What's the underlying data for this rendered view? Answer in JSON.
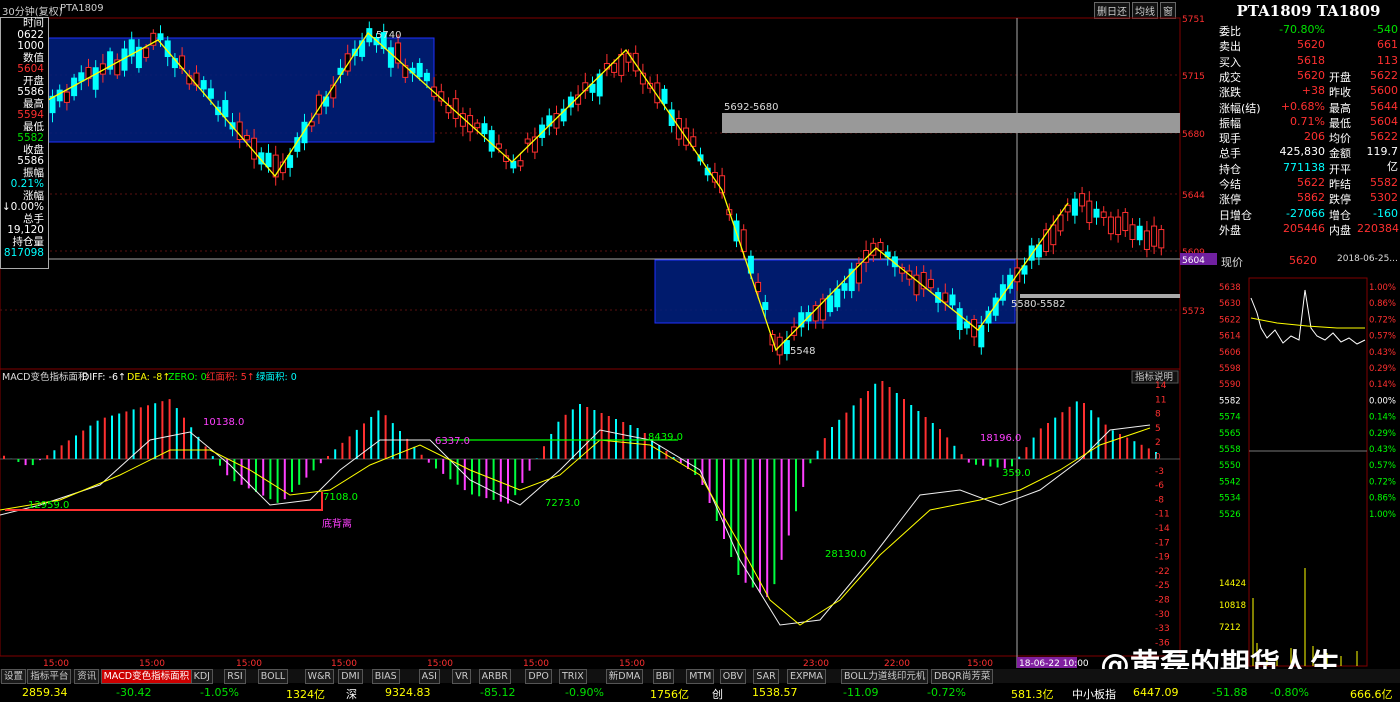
{
  "window": {
    "interval": "30分钟(复权)",
    "symbol": "PTA1809",
    "buttons": [
      "[除]",
      "[除权]",
      "[+]",
      "[x]"
    ],
    "btn_labels": [
      "删日还",
      "均线",
      "窗",
      "|"
    ]
  },
  "left_panel": [
    {
      "label": "时间",
      "value": "0622"
    },
    {
      "label": "",
      "value": "1000"
    },
    {
      "label": "数值",
      "value": "5604"
    },
    {
      "label": "开盘",
      "value": "5586"
    },
    {
      "label": "最高",
      "value": "5594"
    },
    {
      "label": "最低",
      "value": "5582"
    },
    {
      "label": "收盘",
      "value": "5586"
    },
    {
      "label": "振幅",
      "value": "0.21%"
    },
    {
      "label": "涨幅",
      "value": "↓0.00%"
    },
    {
      "label": "总手",
      "value": "19,120"
    },
    {
      "label": "持仓量",
      "value": "817098"
    }
  ],
  "main_chart": {
    "price_labels": [
      "5751",
      "5715",
      "5680",
      "5644",
      "5609",
      "5604",
      "5573"
    ],
    "annotations": [
      "5740",
      "5692-5680",
      "5548",
      "5580-5582"
    ],
    "time_labels": [
      "15:00",
      "15:00",
      "15:00",
      "15:00",
      "15:00",
      "15:00",
      "15:00",
      "23:00",
      "22:00",
      "15:00"
    ],
    "cursor_date": "18-06-22 10:00",
    "current_price_tag": "5604"
  },
  "indicator": {
    "title": "MACD变色指标面积",
    "diff": "DIFF: -6↑",
    "dea": "DEA: -8↑",
    "zero": "ZERO: 0",
    "red_area": "红面积: 5↑",
    "green_area": "绿面积: 0",
    "explain": "指标说明",
    "scale": [
      "14",
      "11",
      "8",
      "5",
      "2",
      "0",
      "-3",
      "-6",
      "-8",
      "-11",
      "-14",
      "-17",
      "-19",
      "-22",
      "-25",
      "-28",
      "-30",
      "-33",
      "-36"
    ],
    "annotations": [
      "10138.0",
      "12959.0",
      "7108.0",
      "底背离",
      "7273.0",
      "8439.0",
      "6337.0",
      "18196.0",
      "359.0",
      "28130.0"
    ]
  },
  "right_panel": {
    "title": "PTA1809 TA1809",
    "rows": [
      {
        "l": "委比",
        "v": "-70.80%",
        "v2": "-540",
        "c": "green"
      },
      {
        "l": "卖出",
        "v": "5620",
        "v2": "661",
        "c": "red"
      },
      {
        "l": "买入",
        "v": "5618",
        "v2": "113",
        "c": "red"
      },
      {
        "l": "成交",
        "v": "5620",
        "l2": "开盘",
        "v2": "5622",
        "c": "red"
      },
      {
        "l": "涨跌",
        "v": "+38",
        "l2": "昨收",
        "v2": "5600",
        "c": "red"
      },
      {
        "l": "涨幅(结)",
        "v": "+0.68%",
        "l2": "最高",
        "v2": "5644",
        "c": "red"
      },
      {
        "l": "振幅",
        "v": "0.71%",
        "l2": "最低",
        "v2": "5604",
        "c": "red"
      },
      {
        "l": "现手",
        "v": "206",
        "l2": "均价",
        "v2": "5622",
        "c": "red"
      },
      {
        "l": "总手",
        "v": "425,830",
        "l2": "金额",
        "v2": "119.7亿",
        "c": "white"
      },
      {
        "l": "持仓",
        "v": "771138",
        "l2": "开平",
        "v2": "",
        "c": "cyan"
      },
      {
        "l": "今结",
        "v": "5622",
        "l2": "昨结",
        "v2": "5582",
        "c": "red"
      },
      {
        "l": "涨停",
        "v": "5862",
        "l2": "跌停",
        "v2": "5302",
        "c": "red"
      },
      {
        "l": "日增仓",
        "v": "-27066",
        "l2": "增仓",
        "v2": "-160",
        "c": "cyan"
      },
      {
        "l": "外盘",
        "v": "205446",
        "l2": "内盘",
        "v2": "220384",
        "c": "red"
      }
    ],
    "now_label": "现价",
    "now_value": "5620",
    "now_date": "2018-06-25...",
    "mini_prices": [
      "5638",
      "5630",
      "5622",
      "5614",
      "5606",
      "5598",
      "5590",
      "5582",
      "5574",
      "5565",
      "5558",
      "5550",
      "5542",
      "5534",
      "5526"
    ],
    "mini_pcts": [
      "1.00%",
      "0.86%",
      "0.72%",
      "0.57%",
      "0.43%",
      "0.29%",
      "0.14%",
      "0.00%",
      "0.14%",
      "0.29%",
      "0.43%",
      "0.57%",
      "0.72%",
      "0.86%",
      "1.00%"
    ],
    "mini_vol": [
      "14424",
      "10818",
      "7212"
    ]
  },
  "tabs": [
    "设置",
    "指标平台",
    "资讯",
    "MACD变色指标面积",
    "KDJ",
    "RSI",
    "BOLL",
    "W&R",
    "DMI",
    "BIAS",
    "ASI",
    "VR",
    "ARBR",
    "DPO",
    "TRIX",
    "新DMA",
    "BBI",
    "MTM",
    "OBV",
    "SAR",
    "EXPMA",
    "BOLL力道线印元机",
    "DBQR尚芳菜"
  ],
  "status": [
    {
      "t": "2859.34",
      "c": "yellow"
    },
    {
      "t": "-30.42",
      "c": "green"
    },
    {
      "t": "-1.05%",
      "c": "green"
    },
    {
      "t": "1324亿",
      "c": "yellow"
    },
    {
      "t": "深",
      "c": "white"
    },
    {
      "t": "9324.83",
      "c": "yellow"
    },
    {
      "t": "-85.12",
      "c": "green"
    },
    {
      "t": "-0.90%",
      "c": "green"
    },
    {
      "t": "1756亿",
      "c": "yellow"
    },
    {
      "t": "创",
      "c": "white"
    },
    {
      "t": "1538.57",
      "c": "yellow"
    },
    {
      "t": "-11.09",
      "c": "green"
    },
    {
      "t": "-0.72%",
      "c": "green"
    },
    {
      "t": "581.3亿",
      "c": "yellow"
    },
    {
      "t": "中小板指",
      "c": "white"
    },
    {
      "t": "6447.09",
      "c": "yellow"
    },
    {
      "t": "-51.88",
      "c": "green"
    },
    {
      "t": "-0.80%",
      "c": "green"
    },
    {
      "t": "666.6亿",
      "c": "yellow"
    }
  ],
  "watermark": "@黄磊的期货人生"
}
